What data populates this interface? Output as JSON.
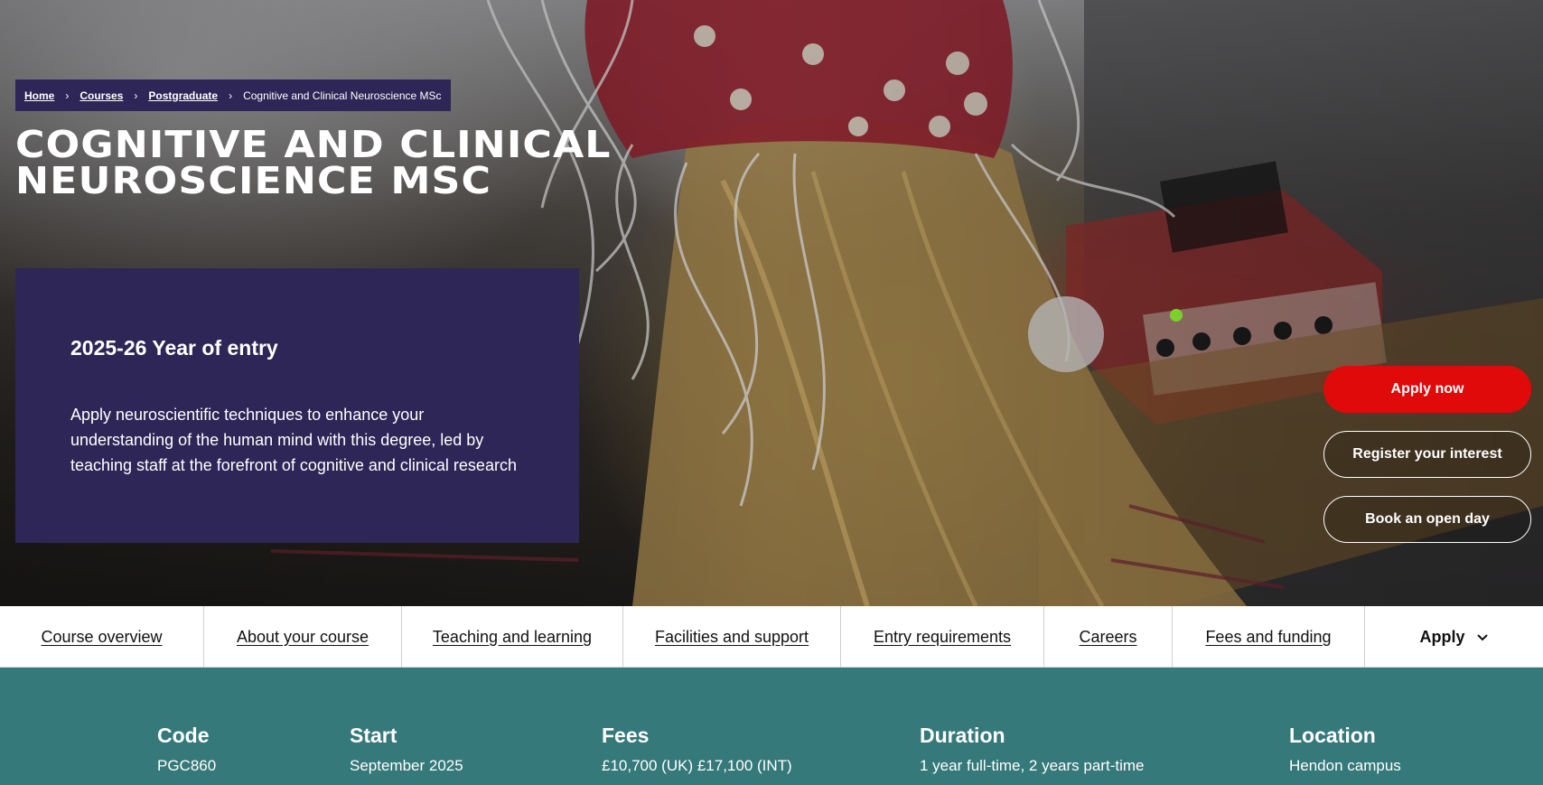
{
  "breadcrumb": {
    "home": "Home",
    "courses": "Courses",
    "postgraduate": "Postgraduate",
    "current": "Cognitive and Clinical Neuroscience MSc"
  },
  "page_title": "COGNITIVE AND CLINICAL NEUROSCIENCE MSC",
  "intro": {
    "year": "2025-26 Year of entry",
    "description": "Apply neuroscientific techniques to enhance your understanding of the human mind with this degree, led by teaching staff at the forefront of cognitive and clinical research"
  },
  "cta": {
    "apply_now": "Apply now",
    "register_interest": "Register your interest",
    "book_open_day": "Book an open day"
  },
  "tabs": [
    {
      "label": "Course overview"
    },
    {
      "label": "About your course"
    },
    {
      "label": "Teaching and learning"
    },
    {
      "label": "Facilities and support"
    },
    {
      "label": "Entry requirements"
    },
    {
      "label": "Careers"
    },
    {
      "label": "Fees and funding"
    },
    {
      "label": "Apply"
    }
  ],
  "info": {
    "code": {
      "label": "Code",
      "value": "PGC860"
    },
    "start": {
      "label": "Start",
      "value": "September 2025"
    },
    "fees": {
      "label": "Fees",
      "value": "£10,700 (UK) £17,100 (INT)"
    },
    "duration": {
      "label": "Duration",
      "value": "1 year full-time, 2 years part-time"
    },
    "location": {
      "label": "Location",
      "value": "Hendon campus"
    }
  },
  "colors": {
    "brand_purple": "#2e2656",
    "apply_red": "#e00a0a",
    "info_teal": "#35797b"
  },
  "icons": {
    "breadcrumb_separator": "chevron-right-icon",
    "apply_dropdown": "chevron-down-icon"
  }
}
